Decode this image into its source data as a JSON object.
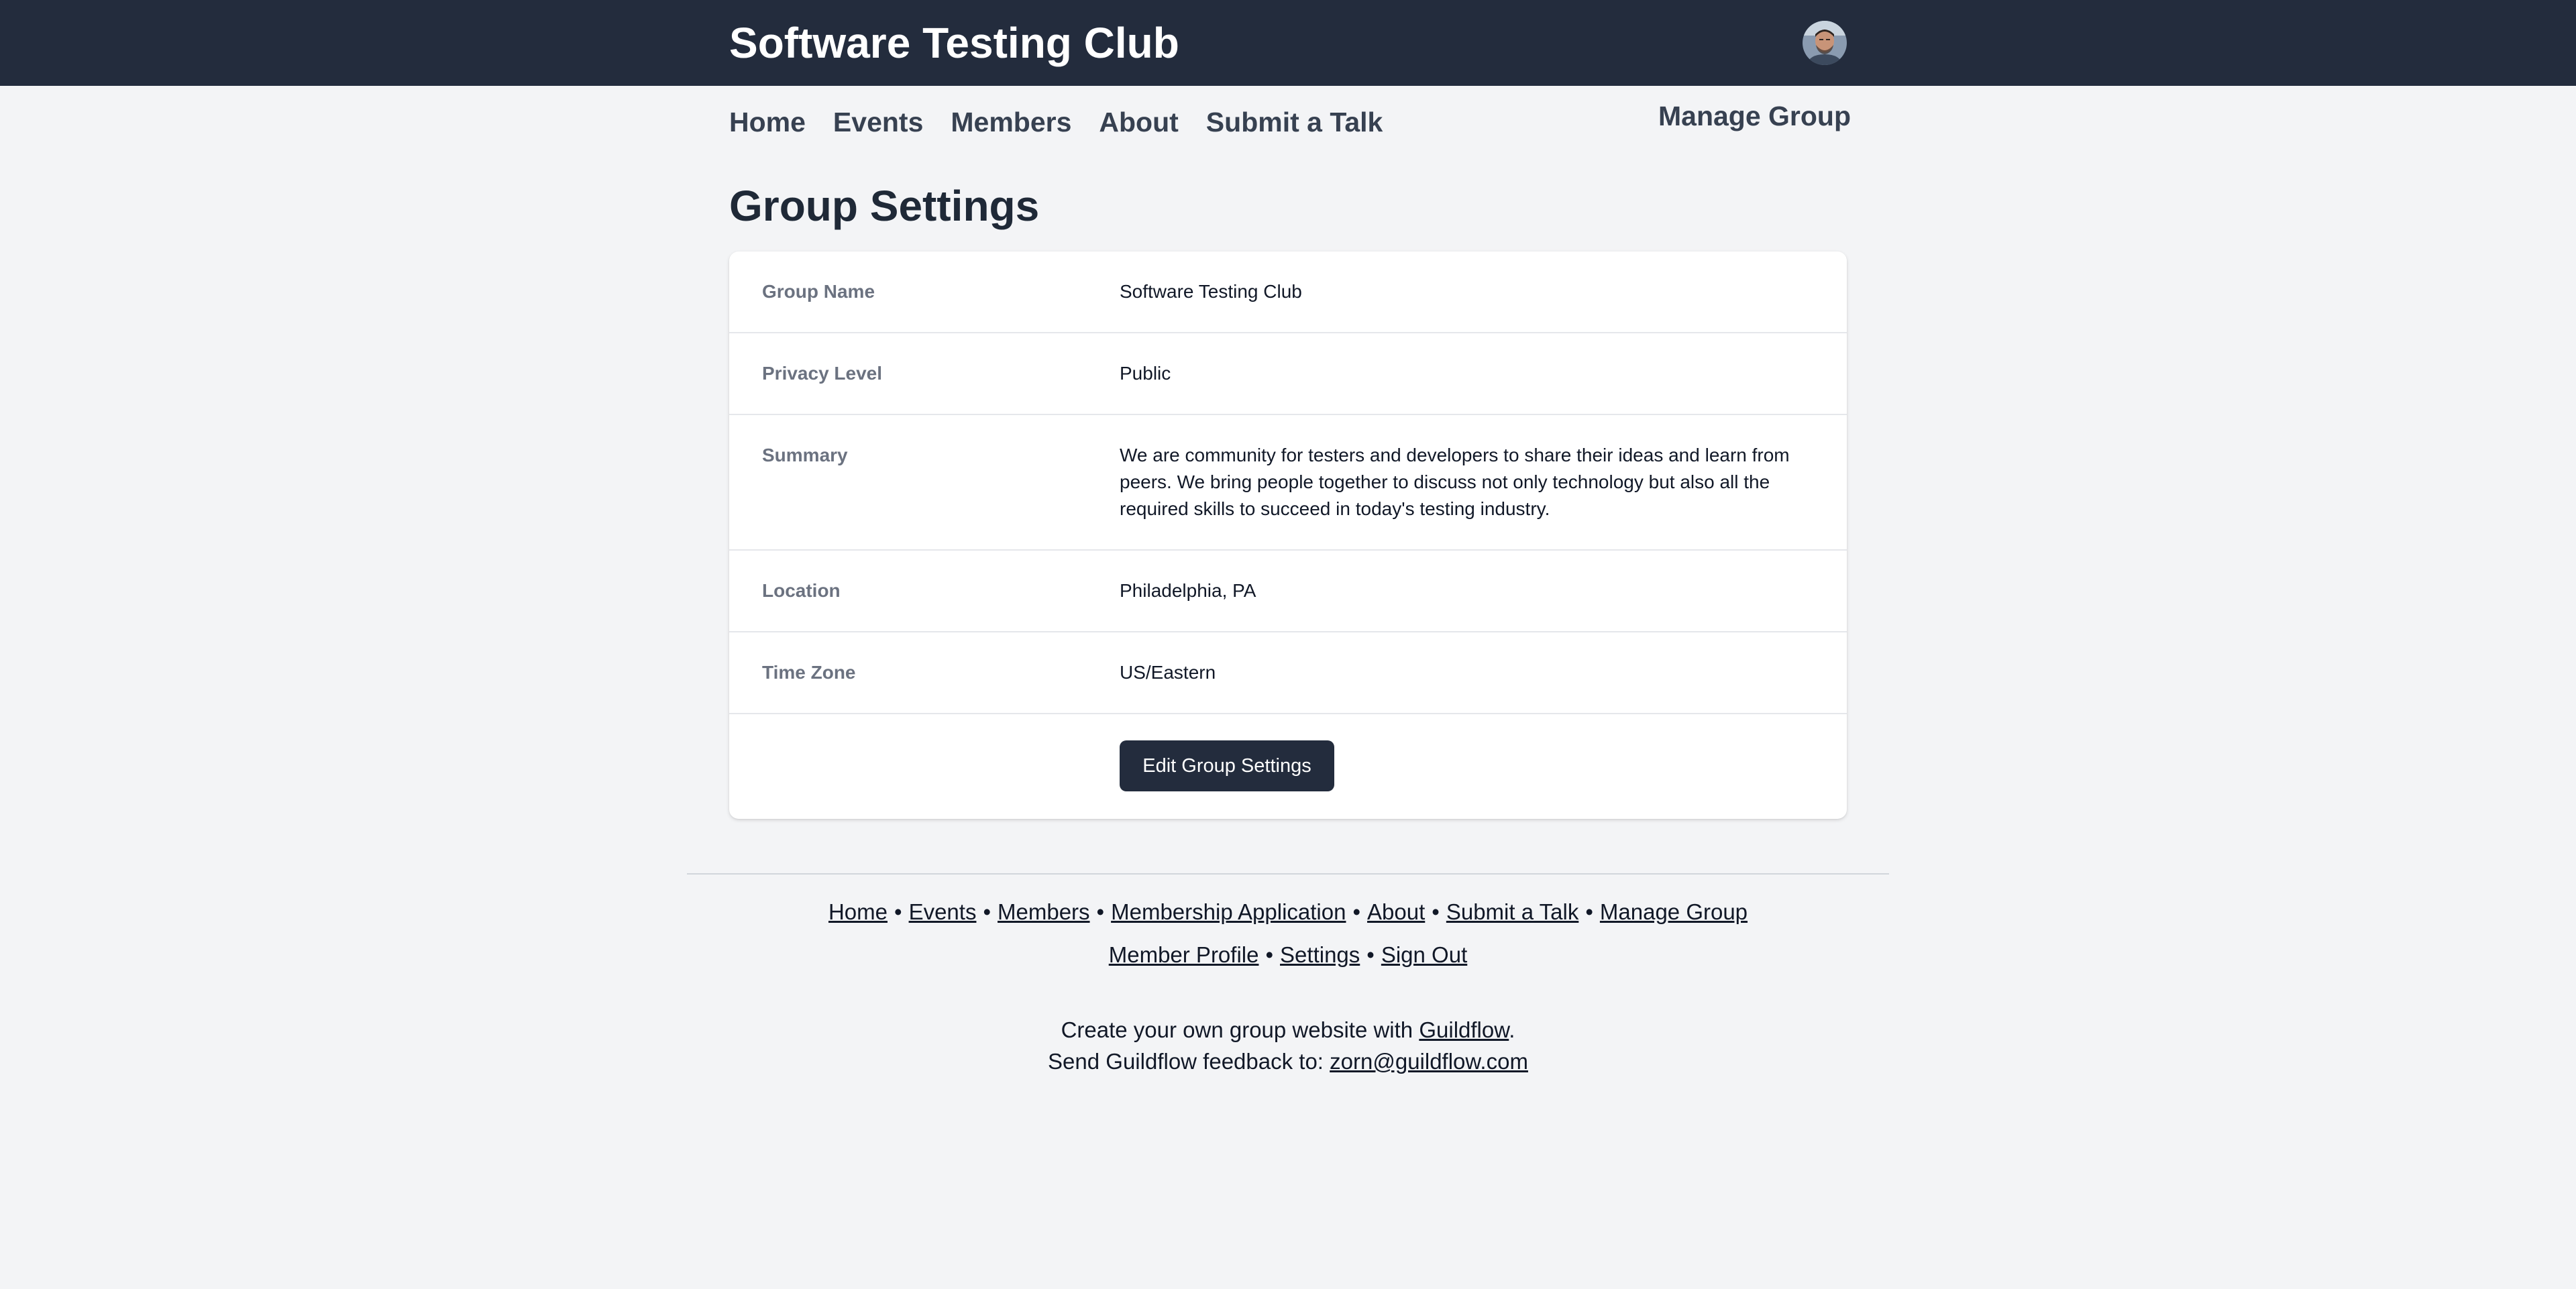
{
  "header": {
    "site_title": "Software Testing Club"
  },
  "nav": {
    "items": [
      {
        "label": "Home"
      },
      {
        "label": "Events"
      },
      {
        "label": "Members"
      },
      {
        "label": "About"
      },
      {
        "label": "Submit a Talk"
      }
    ],
    "manage_label": "Manage Group"
  },
  "page": {
    "title": "Group Settings"
  },
  "settings": {
    "group_name": {
      "label": "Group Name",
      "value": "Software Testing Club"
    },
    "privacy_level": {
      "label": "Privacy Level",
      "value": "Public"
    },
    "summary": {
      "label": "Summary",
      "value": "We are community for testers and developers to share their ideas and learn from peers. We bring people together to discuss not only technology but also all the required skills to succeed in today's testing industry."
    },
    "location": {
      "label": "Location",
      "value": "Philadelphia, PA"
    },
    "time_zone": {
      "label": "Time Zone",
      "value": "US/Eastern"
    },
    "edit_button_label": "Edit Group Settings"
  },
  "footer": {
    "links_row1": [
      "Home",
      "Events",
      "Members",
      "Membership Application",
      "About",
      "Submit a Talk",
      "Manage Group"
    ],
    "links_row2": [
      "Member Profile",
      "Settings",
      "Sign Out"
    ],
    "separator": "•",
    "promo_prefix": "Create your own group website with ",
    "promo_link": "Guildflow",
    "promo_suffix": ".",
    "feedback_prefix": "Send Guildflow feedback to: ",
    "feedback_email": "zorn@guildflow.com"
  },
  "colors": {
    "topbar": "#232c3d",
    "page_background": "#f3f4f6",
    "button": "#232c3d"
  }
}
